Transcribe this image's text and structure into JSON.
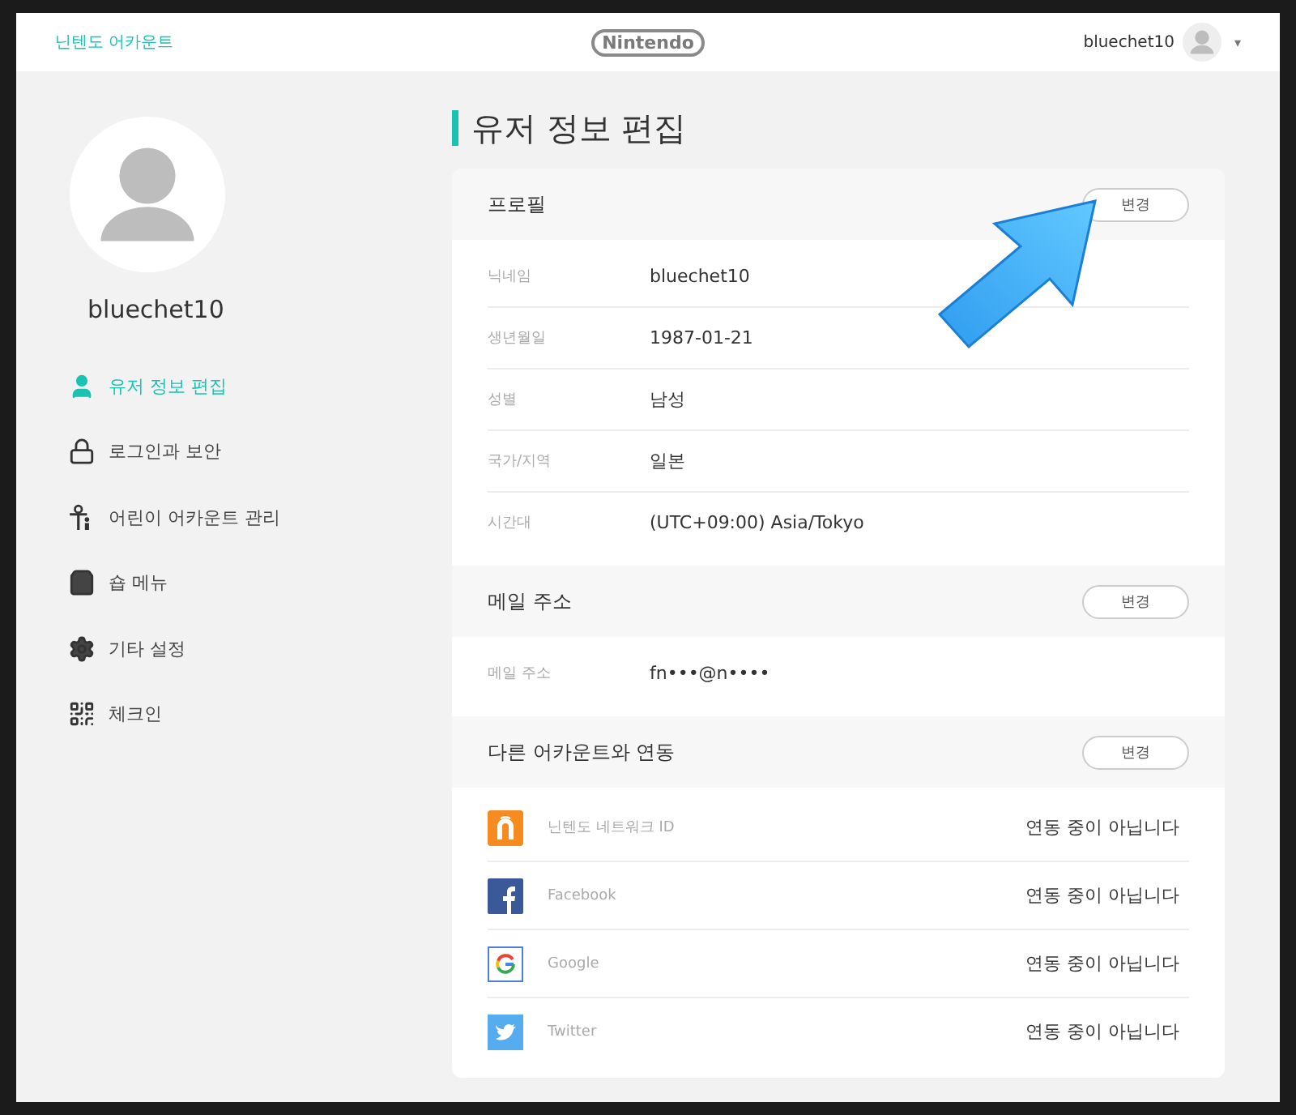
{
  "header": {
    "brand": "닌텐도 어카운트",
    "logo": "Nintendo",
    "username": "bluechet10",
    "caret": "▾"
  },
  "sidebar": {
    "username": "bluechet10",
    "items": [
      {
        "label": "유저 정보 편집",
        "selected": true
      },
      {
        "label": "로그인과 보안",
        "selected": false
      },
      {
        "label": "어린이 어카운트 관리",
        "selected": false
      },
      {
        "label": "숍 메뉴",
        "selected": false
      },
      {
        "label": "기타 설정",
        "selected": false
      },
      {
        "label": "체크인",
        "selected": false
      }
    ]
  },
  "page_title": "유저 정보 편집",
  "sections": [
    {
      "title": "프로필",
      "button": "변경",
      "rows": [
        {
          "label": "닉네임",
          "value": "bluechet10"
        },
        {
          "label": "생년월일",
          "value": "1987-01-21"
        },
        {
          "label": "성별",
          "value": "남성"
        },
        {
          "label": "국가/지역",
          "value": "일본"
        },
        {
          "label": "시간대",
          "value": "(UTC+09:00) Asia/Tokyo"
        }
      ]
    },
    {
      "title": "메일 주소",
      "button": "변경",
      "rows": [
        {
          "label": "메일 주소",
          "value": "fn•••@n••••"
        }
      ]
    }
  ],
  "linked": {
    "title": "다른 어카운트와 연동",
    "button": "변경",
    "accounts": [
      {
        "kind": "nnid",
        "name": "닌텐도 네트워크 ID",
        "status": "연동 중이 아닙니다"
      },
      {
        "kind": "facebook",
        "name": "Facebook",
        "status": "연동 중이 아닙니다"
      },
      {
        "kind": "google",
        "name": "Google",
        "status": "연동 중이 아닙니다"
      },
      {
        "kind": "twitter",
        "name": "Twitter",
        "status": "연동 중이 아닙니다"
      }
    ]
  }
}
